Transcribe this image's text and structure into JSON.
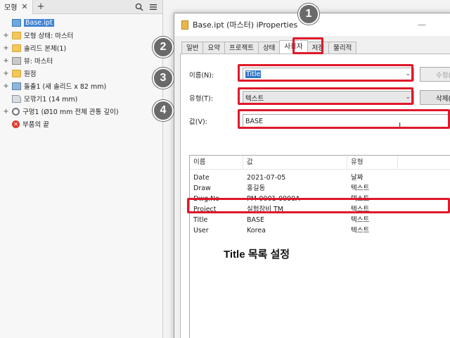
{
  "browser": {
    "tab_label": "모형",
    "tree": [
      {
        "label": "Base.ipt",
        "selected": true,
        "icon": "part-icon"
      },
      {
        "label": "모형 상태: 마스터",
        "icon": "folder-icon"
      },
      {
        "label": "솔리드 본체(1)",
        "icon": "folder-icon"
      },
      {
        "label": "뷰: 마스터",
        "icon": "view-icon"
      },
      {
        "label": "원점",
        "icon": "folder-icon"
      },
      {
        "label": "돌출1 (새 솔리드 x 82 mm)",
        "icon": "extrude-icon"
      },
      {
        "label": "모깎기1 (14 mm)",
        "icon": "fillet-icon"
      },
      {
        "label": "구멍1 (Ø10 mm 전체 관통 깊이)",
        "icon": "hole-icon"
      },
      {
        "label": "부품의 끝",
        "icon": "end-of-part-icon"
      }
    ]
  },
  "dialog": {
    "title": "Base.ipt (마스터) iProperties",
    "tabs": [
      "일반",
      "요약",
      "프로젝트",
      "상태",
      "사용자",
      "저장",
      "물리적"
    ],
    "active_tab": "사용자",
    "name_label": "이름(N):",
    "name_value": "Title",
    "type_label": "유형(T):",
    "type_value": "텍스트",
    "value_label": "값(V):",
    "value_value": "BASE",
    "modify_button": "수정(",
    "delete_button": "삭제(",
    "columns": [
      "이름",
      "값",
      "유형"
    ],
    "rows": [
      {
        "name": "Date",
        "value": "2021-07-05",
        "type": "날짜"
      },
      {
        "name": "Draw",
        "value": "홍길동",
        "type": "텍스트"
      },
      {
        "name": "Dwg.No",
        "value": "PM-0001-0000A",
        "type": "텍스트"
      },
      {
        "name": "Project",
        "value": "실험장비 TM",
        "type": "텍스트"
      },
      {
        "name": "Title",
        "value": "BASE",
        "type": "텍스트"
      },
      {
        "name": "User",
        "value": "Korea",
        "type": "텍스트"
      }
    ]
  },
  "annotation": {
    "steps": [
      "1",
      "2",
      "3",
      "4"
    ],
    "caption": "Title 목록 설정"
  },
  "colors": {
    "highlight_red": "#e0182a",
    "badge_gray": "#6a6a6a",
    "selection_blue": "#3178c6"
  }
}
